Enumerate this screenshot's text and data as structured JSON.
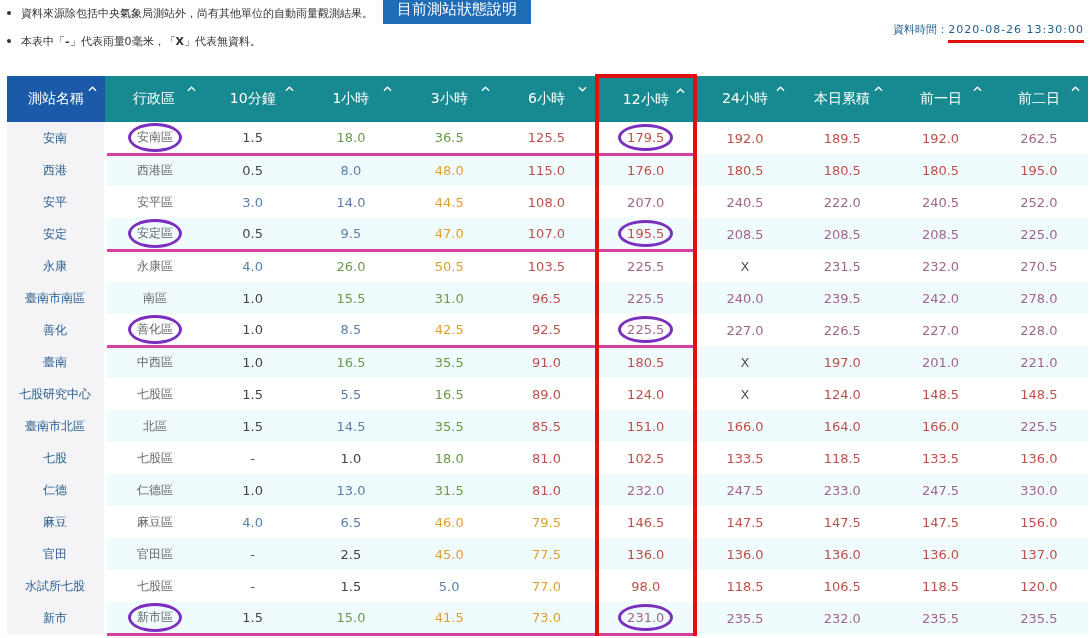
{
  "notes": [
    {
      "text": "資料來源除包括中央氣象局測站外，尚有其他單位的自動雨量觀測結果。"
    },
    {
      "text": "本表中「**-**」代表雨量0毫米，「**X**」代表無資料。"
    }
  ],
  "status_button": "目前測站狀態說明",
  "data_time": {
    "label": "資料時間：",
    "value": "2020-08-26 13:30:00",
    "underlined": true
  },
  "table": {
    "columns": [
      {
        "label": "測站名稱",
        "sorted": false,
        "boxed": false
      },
      {
        "label": "行政區",
        "sorted": false,
        "boxed": false
      },
      {
        "label": "10分鐘",
        "sorted": false,
        "boxed": false
      },
      {
        "label": "1小時",
        "sorted": false,
        "boxed": false
      },
      {
        "label": "3小時",
        "sorted": false,
        "boxed": false
      },
      {
        "label": "6小時",
        "sorted": true,
        "boxed": false
      },
      {
        "label": "12小時",
        "sorted": false,
        "boxed": true
      },
      {
        "label": "24小時",
        "sorted": false,
        "boxed": false
      },
      {
        "label": "本日累積",
        "sorted": false,
        "boxed": false
      },
      {
        "label": "前一日",
        "sorted": false,
        "boxed": false
      },
      {
        "label": "前二日",
        "sorted": false,
        "boxed": false
      }
    ],
    "rows": [
      {
        "station": "安南",
        "district": "安南區",
        "marked": true,
        "values": [
          "1.5",
          "18.0",
          "36.5",
          "125.5",
          "179.5",
          "192.0",
          "189.5",
          "192.0",
          "262.5"
        ]
      },
      {
        "station": "西港",
        "district": "西港區",
        "marked": false,
        "values": [
          "0.5",
          "8.0",
          "48.0",
          "115.0",
          "176.0",
          "180.5",
          "180.5",
          "180.5",
          "195.0"
        ]
      },
      {
        "station": "安平",
        "district": "安平區",
        "marked": false,
        "values": [
          "3.0",
          "14.0",
          "44.5",
          "108.0",
          "207.0",
          "240.5",
          "222.0",
          "240.5",
          "252.0"
        ]
      },
      {
        "station": "安定",
        "district": "安定區",
        "marked": true,
        "values": [
          "0.5",
          "9.5",
          "47.0",
          "107.0",
          "195.5",
          "208.5",
          "208.5",
          "208.5",
          "225.0"
        ]
      },
      {
        "station": "永康",
        "district": "永康區",
        "marked": false,
        "values": [
          "4.0",
          "26.0",
          "50.5",
          "103.5",
          "225.5",
          "X",
          "231.5",
          "232.0",
          "270.5"
        ]
      },
      {
        "station": "臺南市南區",
        "district": "南區",
        "marked": false,
        "values": [
          "1.0",
          "15.5",
          "31.0",
          "96.5",
          "225.5",
          "240.0",
          "239.5",
          "242.0",
          "278.0"
        ]
      },
      {
        "station": "善化",
        "district": "善化區",
        "marked": true,
        "values": [
          "1.0",
          "8.5",
          "42.5",
          "92.5",
          "225.5",
          "227.0",
          "226.5",
          "227.0",
          "228.0"
        ]
      },
      {
        "station": "臺南",
        "district": "中西區",
        "marked": false,
        "values": [
          "1.0",
          "16.5",
          "35.5",
          "91.0",
          "180.5",
          "X",
          "197.0",
          "201.0",
          "221.0"
        ]
      },
      {
        "station": "七股研究中心",
        "district": "七股區",
        "marked": false,
        "values": [
          "1.5",
          "5.5",
          "16.5",
          "89.0",
          "124.0",
          "X",
          "124.0",
          "148.5",
          "148.5"
        ]
      },
      {
        "station": "臺南市北區",
        "district": "北區",
        "marked": false,
        "values": [
          "1.5",
          "14.5",
          "35.5",
          "85.5",
          "151.0",
          "166.0",
          "164.0",
          "166.0",
          "225.5"
        ]
      },
      {
        "station": "七股",
        "district": "七股區",
        "marked": false,
        "values": [
          "-",
          "1.0",
          "18.0",
          "81.0",
          "102.5",
          "133.5",
          "118.5",
          "133.5",
          "136.0"
        ]
      },
      {
        "station": "仁德",
        "district": "仁德區",
        "marked": false,
        "values": [
          "1.0",
          "13.0",
          "31.5",
          "81.0",
          "232.0",
          "247.5",
          "233.0",
          "247.5",
          "330.0"
        ]
      },
      {
        "station": "麻豆",
        "district": "麻豆區",
        "marked": false,
        "values": [
          "4.0",
          "6.5",
          "46.0",
          "79.5",
          "146.5",
          "147.5",
          "147.5",
          "147.5",
          "156.0"
        ]
      },
      {
        "station": "官田",
        "district": "官田區",
        "marked": false,
        "values": [
          "-",
          "2.5",
          "45.0",
          "77.5",
          "136.0",
          "136.0",
          "136.0",
          "136.0",
          "137.0"
        ]
      },
      {
        "station": "水試所七股",
        "district": "七股區",
        "marked": false,
        "values": [
          "-",
          "1.5",
          "5.0",
          "77.0",
          "98.0",
          "118.5",
          "106.5",
          "118.5",
          "120.0"
        ]
      },
      {
        "station": "新市",
        "district": "新市區",
        "marked": true,
        "values": [
          "1.5",
          "15.0",
          "41.5",
          "73.0",
          "231.0",
          "235.5",
          "232.0",
          "235.5",
          "235.5"
        ]
      }
    ]
  }
}
